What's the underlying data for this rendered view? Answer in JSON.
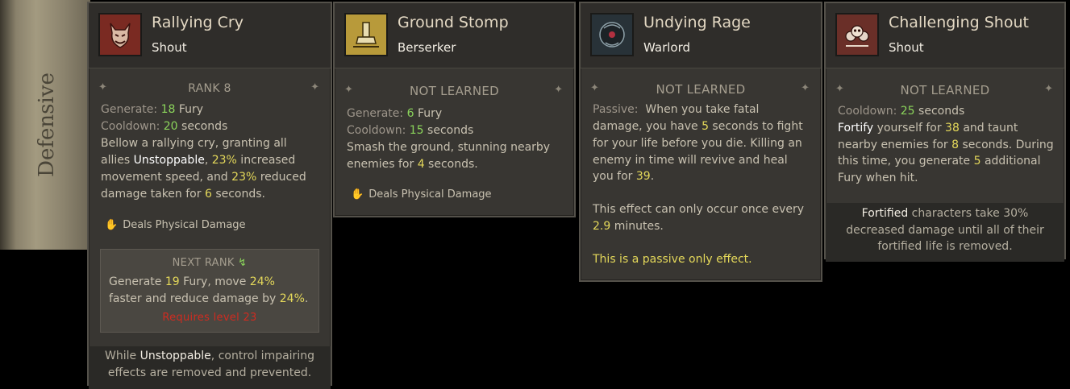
{
  "sidebar": {
    "label": "Defensive"
  },
  "cards": {
    "rally": {
      "name": "Rallying Cry",
      "type": "Shout",
      "rank": "RANK 8",
      "generate_label": "Generate:",
      "generate_value": "18",
      "generate_unit": "Fury",
      "cooldown_label": "Cooldown:",
      "cooldown_value": "20",
      "cooldown_unit": "seconds",
      "desc1": "Bellow a rallying cry, granting all",
      "desc2a": "allies ",
      "desc2b": "Unstoppable",
      "desc2c": ", ",
      "desc2d": "23%",
      "desc2e": " increased",
      "desc3a": "movement speed, and ",
      "desc3b": "23%",
      "desc3c": " reduced",
      "desc4a": "damage taken for ",
      "desc4b": "6",
      "desc4c": " seconds.",
      "damage": "Deals Physical Damage",
      "next_rank_label": "NEXT RANK",
      "next1a": "Generate ",
      "next1b": "19",
      "next1c": " Fury, move ",
      "next1d": "24%",
      "next2a": "faster and reduce damage by ",
      "next2b": "24%",
      "next2c": ".",
      "requires": "Requires level 23",
      "footer1a": "While ",
      "footer1b": "Unstoppable",
      "footer1c": ", control impairing",
      "footer2": "effects are removed and prevented."
    },
    "stomp": {
      "name": "Ground Stomp",
      "type": "Berserker",
      "rank": "NOT LEARNED",
      "generate_label": "Generate:",
      "generate_value": "6",
      "generate_unit": "Fury",
      "cooldown_label": "Cooldown:",
      "cooldown_value": "15",
      "cooldown_unit": "seconds",
      "desc1": "Smash the ground, stunning nearby",
      "desc2a": "enemies for ",
      "desc2b": "4",
      "desc2c": " seconds.",
      "damage": "Deals Physical Damage"
    },
    "rage": {
      "name": "Undying Rage",
      "type": "Warlord",
      "rank": "NOT LEARNED",
      "passive_label": "Passive:",
      "d1": "When you take fatal",
      "d2a": "damage, you have ",
      "d2b": "5",
      "d2c": " seconds to fight",
      "d3": "for your life before you die. Killing an",
      "d4": "enemy in time will revive and heal",
      "d5a": "you for ",
      "d5b": "39",
      "d5c": ".",
      "e1": "This effect can only occur once every",
      "e2a": "2.9",
      "e2b": " minutes.",
      "passive_note": "This is a passive only effect."
    },
    "shout": {
      "name": "Challenging Shout",
      "type": "Shout",
      "rank": "NOT LEARNED",
      "cooldown_label": "Cooldown:",
      "cooldown_value": "25",
      "cooldown_unit": "seconds",
      "d1a": "Fortify",
      "d1b": " yourself for ",
      "d1c": "38",
      "d1d": " and taunt",
      "d2a": "nearby enemies for ",
      "d2b": "8",
      "d2c": " seconds. During",
      "d3a": "this time, you generate ",
      "d3b": "5",
      "d3c": " additional",
      "d4": "Fury when hit.",
      "footer1a": "Fortified",
      "footer1b": " characters take 30%",
      "footer2": "decreased damage until all of their",
      "footer3": "fortified life is removed."
    }
  },
  "colors": {
    "green_value": "#8bd45b",
    "yellow_value": "#e4d85a",
    "requirement_red": "#d02b20"
  },
  "icons": {
    "rally": "demon-face-icon",
    "stomp": "foot-stomp-icon",
    "rage": "dark-orb-icon",
    "shout": "triple-skull-icon",
    "damage": "fist-icon"
  }
}
